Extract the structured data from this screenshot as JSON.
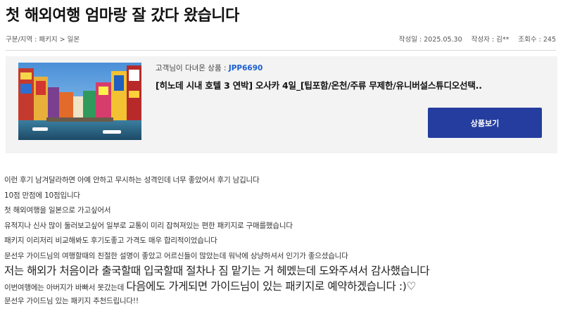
{
  "title": "첫 해외여행 엄마랑 잘 갔다 왔습니다",
  "breadcrumb": "구분/지역 : 패키지 > 일본",
  "meta": {
    "date": "작성일 : 2025.05.30",
    "author": "작성자 : 김**",
    "views": "조회수 : 245"
  },
  "product": {
    "label": "고객님이 다녀온 상품 : ",
    "code": "JPP6690",
    "name": "[히노데 시내 호텔 3 연박] 오사카 4일_[팁포함/온천/주류 무제한/유니버설스튜디오선택..",
    "button_label": "상품보기",
    "image_alt": "osaka-dotonbori-photo"
  },
  "review": {
    "lines": [
      " 이런 후기 남겨달라하면 아예 안하고 무시하는 성격인데 너무 좋았어서 후기 남깁니다",
      "10점 만점에 10점입니다",
      "첫 해외여행을 일본으로 가고싶어서",
      "유적지나 신사 많이 둘러보고싶어 일부로 교통이 미리 잡혀져있는 편한 패키지로 구매를했습니다",
      "패키지 이리저리 비교해봐도 후기도좋고 가격도 매우 합리적이었습니다",
      "문선우 가이드님의 여행할때의 친절한 설명이 좋았고 어르신들이 많았는데 워낙에 상냥하셔서 인기가 좋으셨습니다",
      "저는 해외가 처음이라 출국할때 입국할때 절차나 짐 맡기는 거 헤멨는데 도와주셔서 감사했습니다"
    ],
    "line8_small": "이번여행에는 아버지가 바빠서 못갔는데 ",
    "line8_big": "다음에도 가게되면 가이드님이 있는 패키지로 예약하겠습니다 :)♡",
    "line9": "문선우 가이드님 있는 패키지 추천드립니다!!"
  }
}
